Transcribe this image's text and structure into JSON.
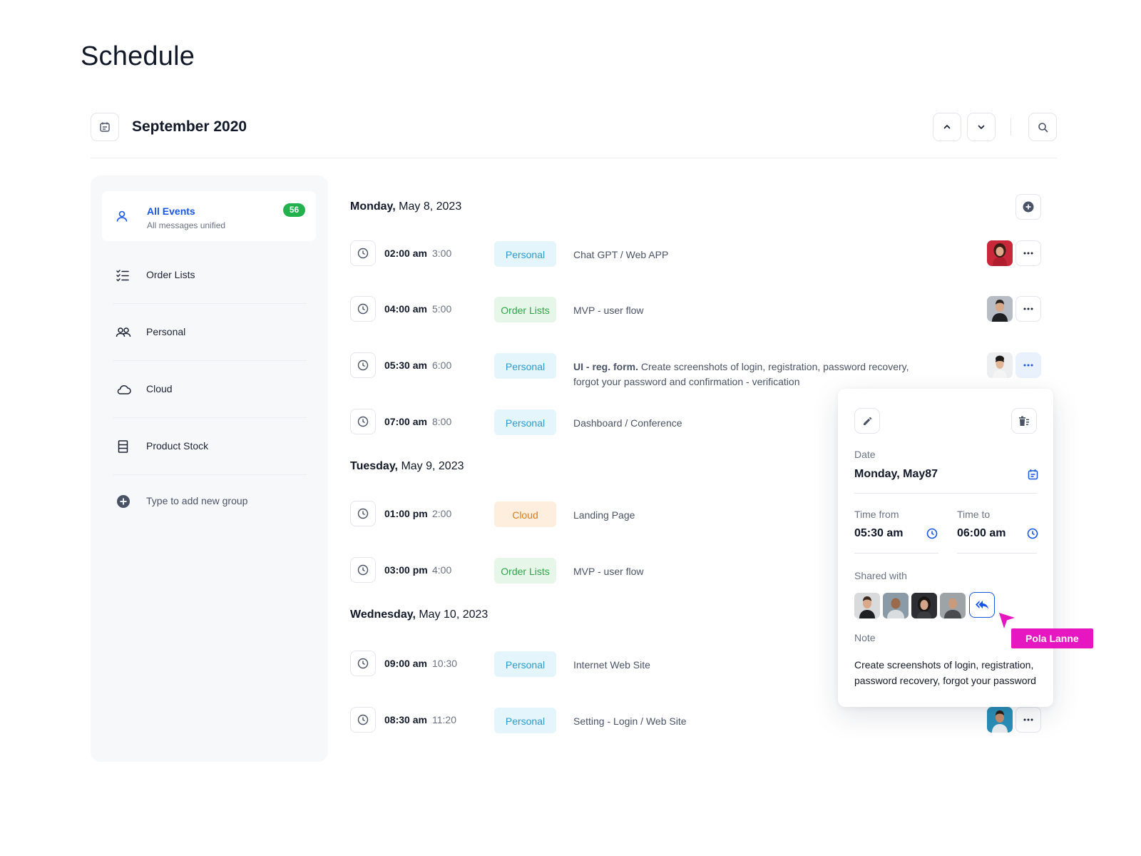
{
  "page": {
    "title": "Schedule"
  },
  "toolbar": {
    "month": "September 2020"
  },
  "sidebar": {
    "all_events": {
      "title": "All Events",
      "subtitle": "All messages unified",
      "count": "56"
    },
    "items": [
      {
        "label": "Order Lists",
        "icon": "checklist-icon"
      },
      {
        "label": "Personal",
        "icon": "users-icon"
      },
      {
        "label": "Cloud",
        "icon": "cloud-icon"
      },
      {
        "label": "Product Stock",
        "icon": "stock-icon"
      },
      {
        "label": "Type to add new group",
        "icon": "plus-circle-icon"
      }
    ]
  },
  "days": [
    {
      "weekday": "Monday,",
      "date": "May 8, 2023",
      "events": [
        {
          "time": "02:00 am",
          "duration": "3:00",
          "tag": "Personal",
          "title": "Chat GPT / Web APP"
        },
        {
          "time": "04:00 am",
          "duration": "5:00",
          "tag": "Order Lists",
          "title": "MVP - user flow"
        },
        {
          "time": "05:30 am",
          "duration": "6:00",
          "tag": "Personal",
          "title_bold": "UI - reg. form.",
          "title": "Create screenshots of login, registration, password recovery, forgot your password and confirmation - verification"
        },
        {
          "time": "07:00 am",
          "duration": "8:00",
          "tag": "Personal",
          "title": "Dashboard / Conference"
        }
      ]
    },
    {
      "weekday": "Tuesday,",
      "date": "May 9, 2023",
      "events": [
        {
          "time": "01:00 pm",
          "duration": "2:00",
          "tag": "Cloud",
          "title": "Landing Page"
        },
        {
          "time": "03:00 pm",
          "duration": "4:00",
          "tag": "Order Lists",
          "title": "MVP - user flow"
        }
      ]
    },
    {
      "weekday": "Wednesday,",
      "date": "May 10, 2023",
      "events": [
        {
          "time": "09:00 am",
          "duration": "10:30",
          "tag": "Personal",
          "title": "Internet Web Site"
        },
        {
          "time": "08:30 am",
          "duration": "11:20",
          "tag": "Personal",
          "title": "Setting - Login / Web Site"
        }
      ]
    }
  ],
  "popover": {
    "date_label": "Date",
    "date_value": "Monday, May87",
    "time_from_label": "Time from",
    "time_from_value": "05:30 am",
    "time_to_label": "Time to",
    "time_to_value": "06:00 am",
    "shared_label": "Shared with",
    "note_label": "Note",
    "note_text": "Create screenshots of login, registration, password recovery, forgot your password"
  },
  "cursor": {
    "name": "Pola Lanne"
  },
  "colors": {
    "accent": "#1756e6",
    "badge_green": "#22b14c",
    "cursor_magenta": "#e617c0",
    "tag_personal": "#2a9bd1",
    "tag_order": "#2aa645",
    "tag_cloud": "#e07d1c"
  }
}
